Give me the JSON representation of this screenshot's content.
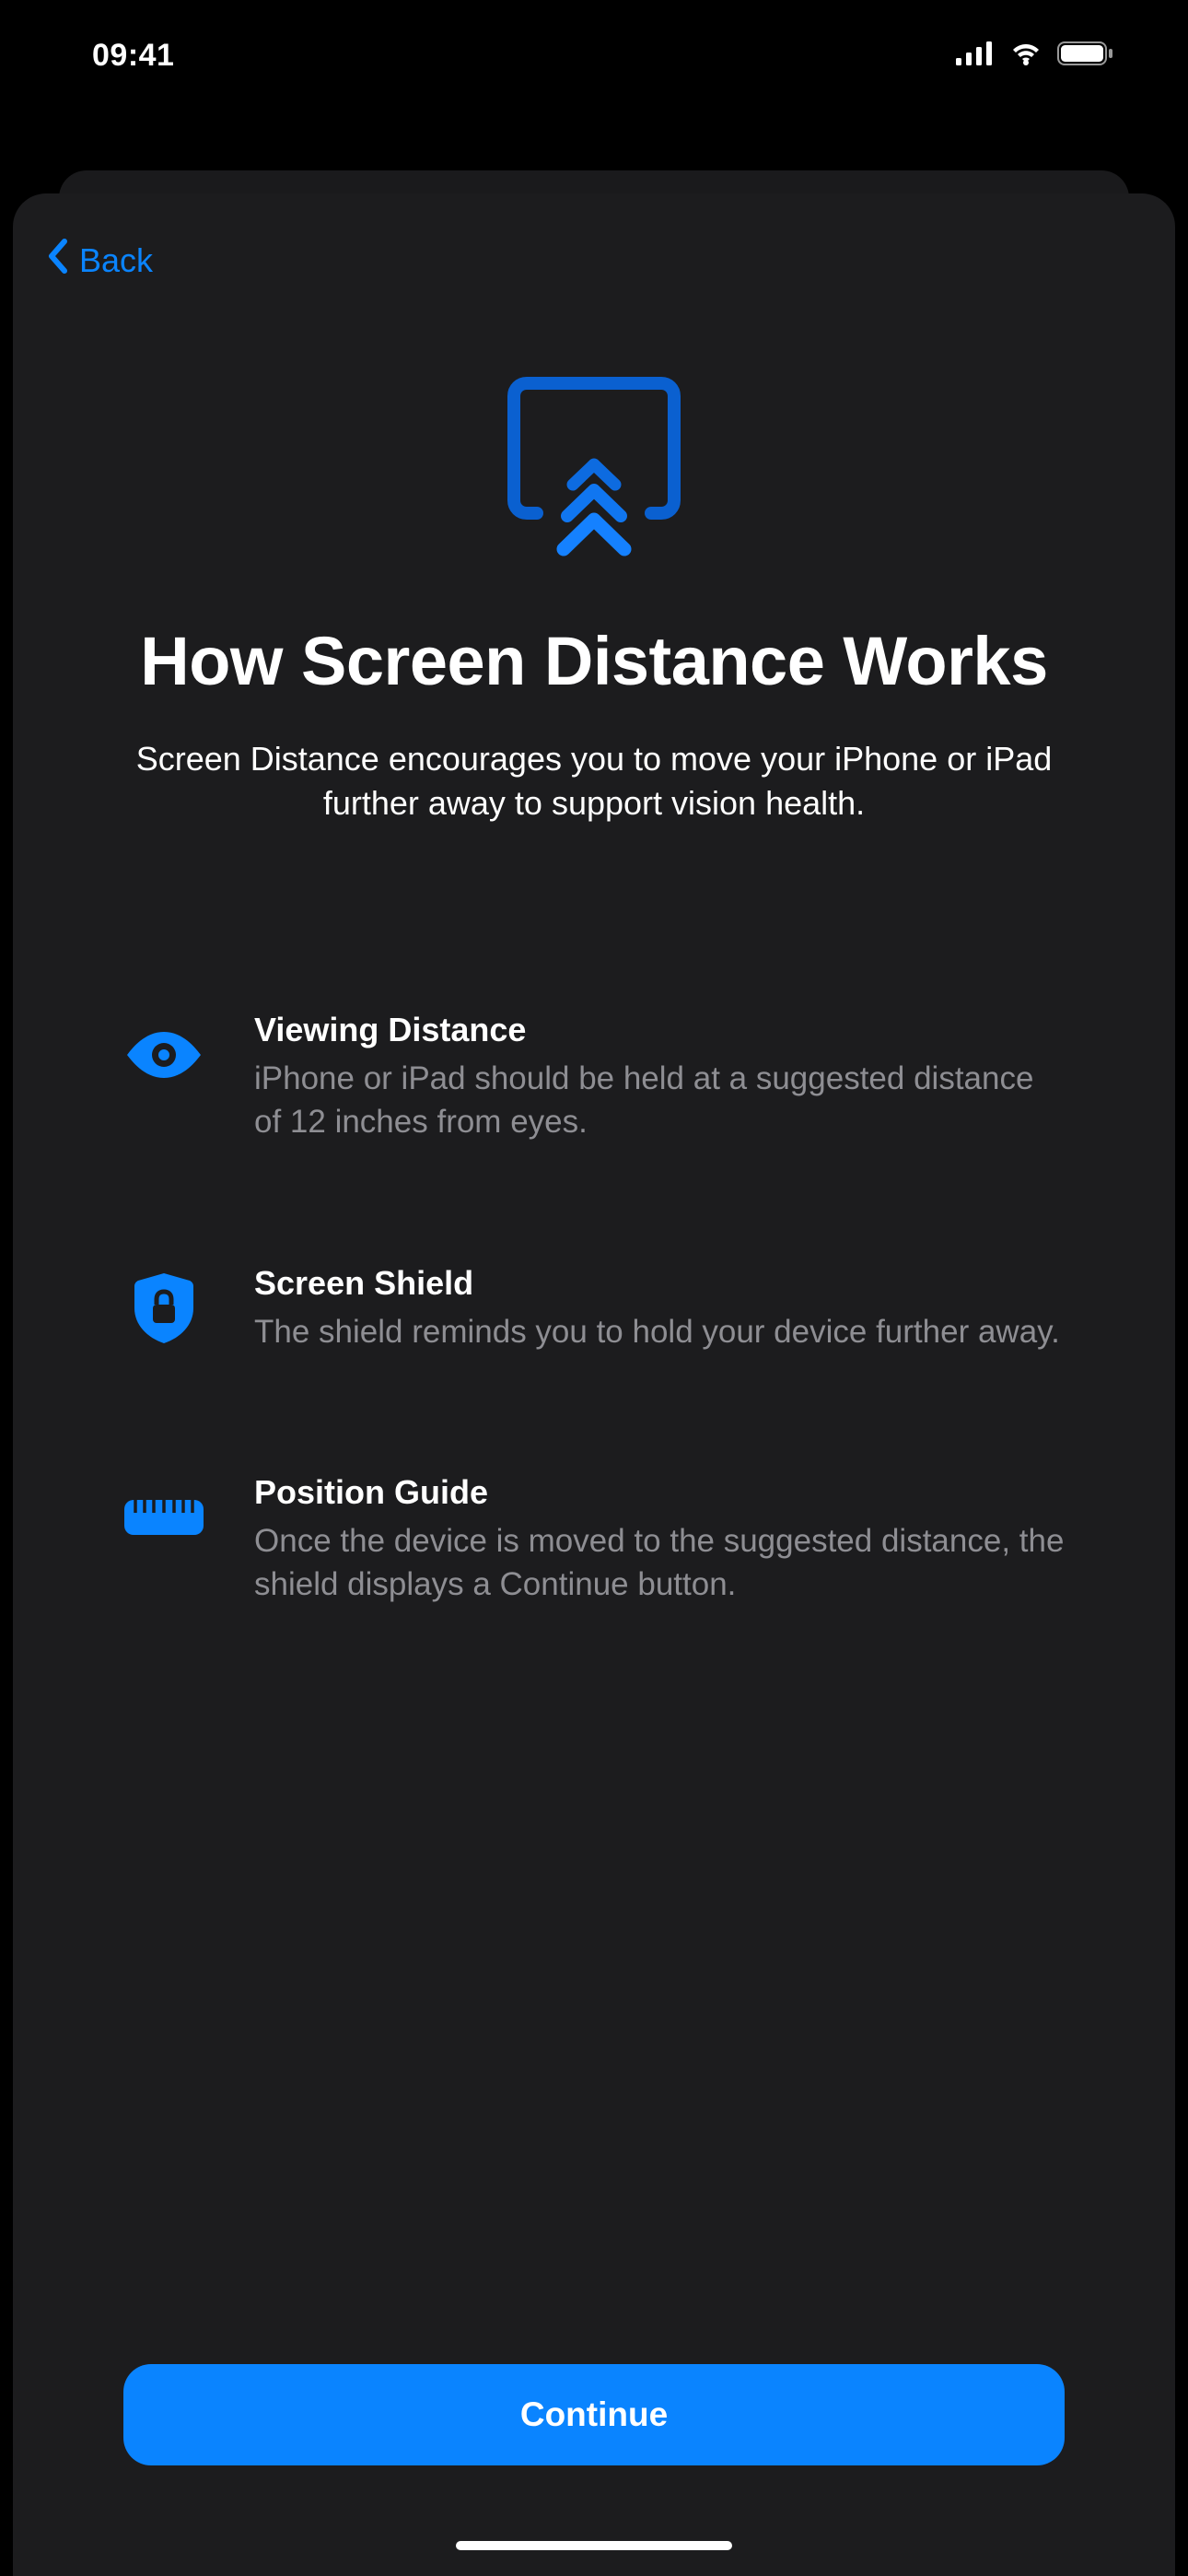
{
  "statusBar": {
    "time": "09:41"
  },
  "nav": {
    "back_label": "Back"
  },
  "hero": {
    "title": "How Screen Distance Works",
    "subtitle": "Screen Distance encourages you to move your iPhone or iPad further away to support vision health."
  },
  "features": [
    {
      "icon": "eye-icon",
      "title": "Viewing Distance",
      "desc": "iPhone or iPad should be held at a suggested distance of 12 inches from eyes."
    },
    {
      "icon": "shield-lock-icon",
      "title": "Screen Shield",
      "desc": "The shield reminds you to hold your device further away."
    },
    {
      "icon": "ruler-icon",
      "title": "Position Guide",
      "desc": "Once the device is moved to the suggested distance, the shield displays a Continue button."
    }
  ],
  "footer": {
    "continue_label": "Continue"
  },
  "colors": {
    "accent": "#0a84ff",
    "sheet_bg": "#1c1c1e",
    "secondary_text": "#8e8e93"
  }
}
